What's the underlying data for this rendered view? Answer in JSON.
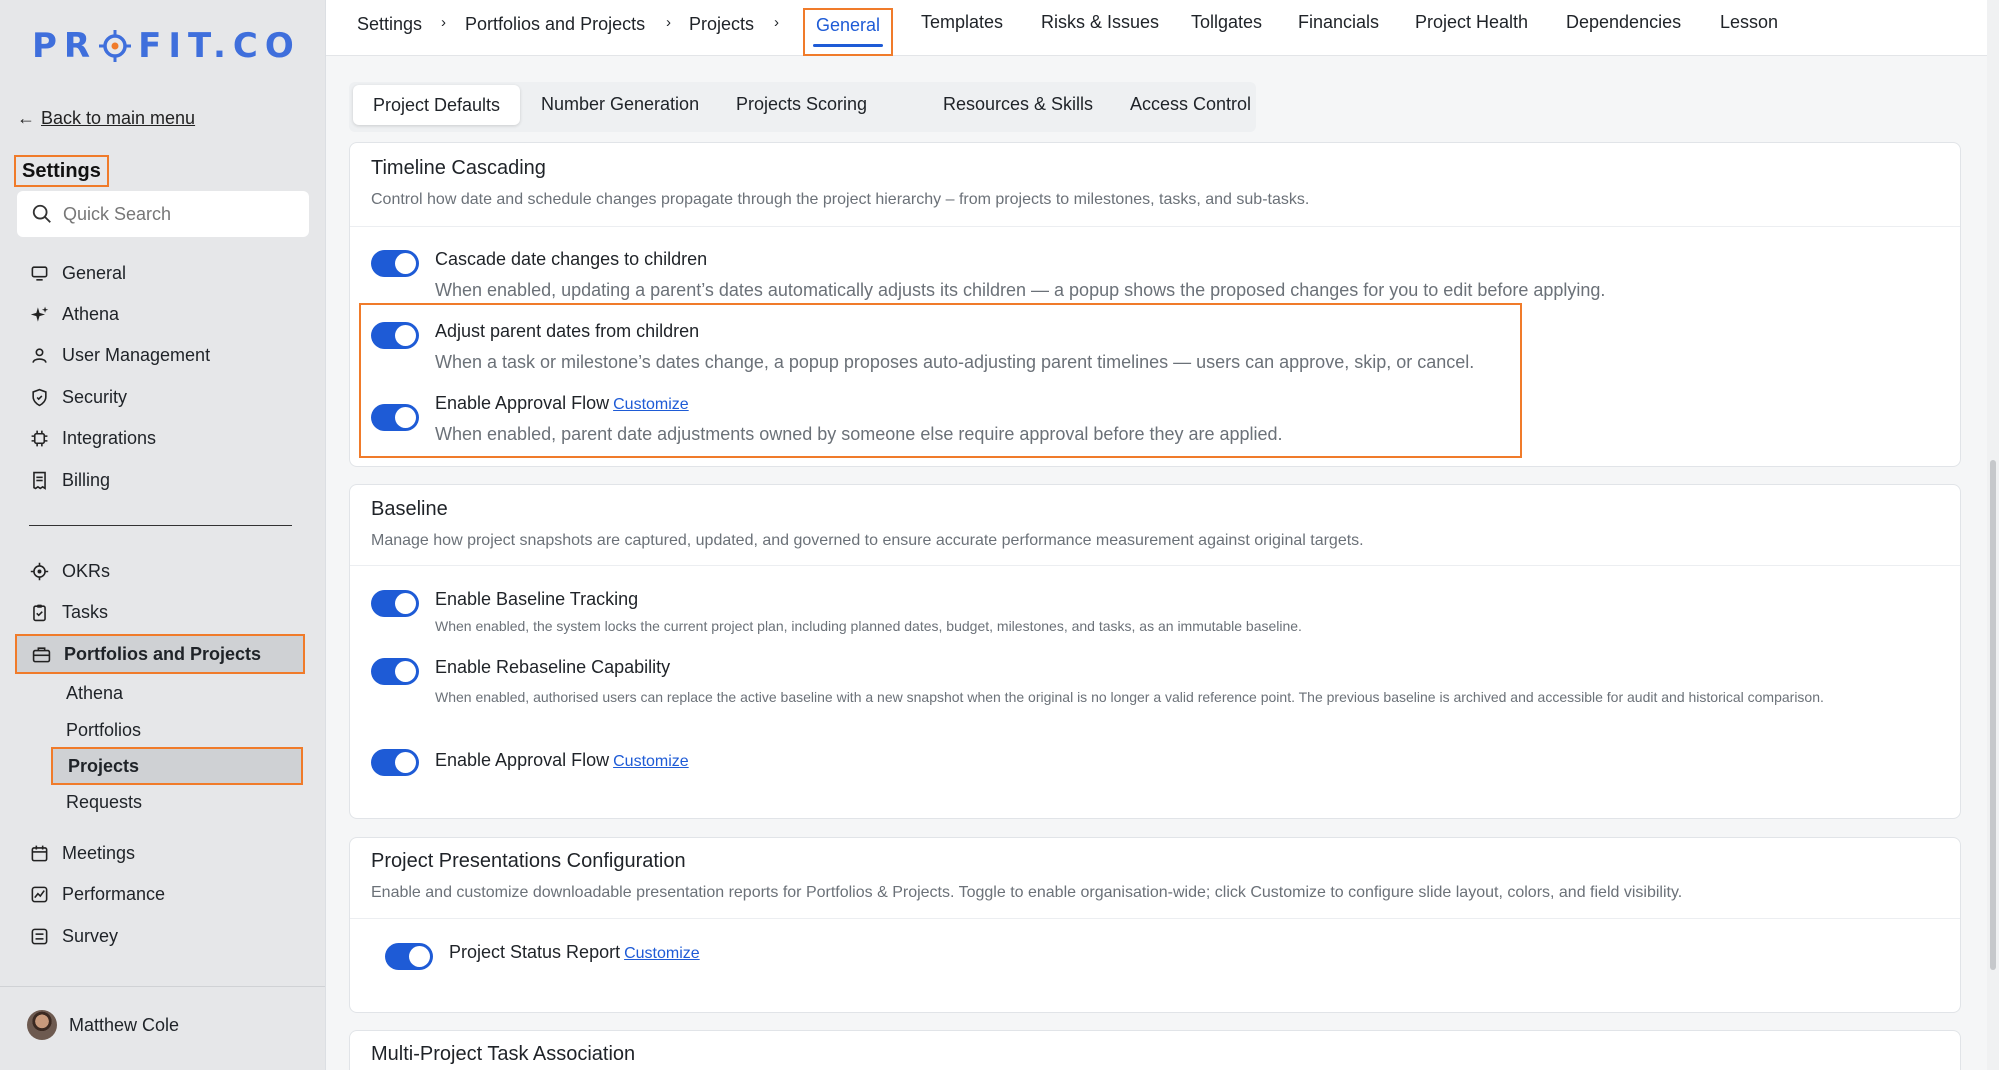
{
  "app": {
    "logo_text_left": "PR",
    "logo_text_right": "FIT.CO"
  },
  "sidebar": {
    "back_label": "Back to main menu",
    "settings_title": "Settings",
    "search_placeholder": "Quick Search",
    "items": [
      {
        "label": "General",
        "icon": "monitor-icon"
      },
      {
        "label": "Athena",
        "icon": "sparkle-icon"
      },
      {
        "label": "User Management",
        "icon": "user-icon"
      },
      {
        "label": "Security",
        "icon": "shield-icon"
      },
      {
        "label": "Integrations",
        "icon": "chip-icon"
      },
      {
        "label": "Billing",
        "icon": "receipt-icon"
      }
    ],
    "items2": [
      {
        "label": "OKRs",
        "icon": "target-icon"
      },
      {
        "label": "Tasks",
        "icon": "clipboard-check-icon"
      },
      {
        "label": "Portfolios and Projects",
        "icon": "briefcase-icon"
      }
    ],
    "sub_items": [
      "Athena",
      "Portfolios",
      "Projects",
      "Requests"
    ],
    "items3": [
      {
        "label": "Meetings",
        "icon": "calendar-icon"
      },
      {
        "label": "Performance",
        "icon": "chart-icon"
      },
      {
        "label": "Survey",
        "icon": "survey-icon"
      }
    ],
    "user_name": "Matthew Cole"
  },
  "breadcrumb": [
    "Settings",
    "Portfolios and Projects",
    "Projects"
  ],
  "tabs": [
    "General",
    "Templates",
    "Risks & Issues",
    "Tollgates",
    "Financials",
    "Project Health",
    "Dependencies",
    "Lesson"
  ],
  "subtabs": [
    "Project Defaults",
    "Number Generation",
    "Projects Scoring",
    "Resources & Skills",
    "Access Control"
  ],
  "timeline": {
    "title": "Timeline Cascading",
    "desc": "Control how date and schedule changes propagate through the project hierarchy – from projects to milestones, tasks, and sub-tasks.",
    "options": [
      {
        "label": "Cascade date changes to children",
        "desc": "When enabled, updating a parent’s dates automatically adjusts its children — a popup shows the proposed changes for you to edit before applying."
      },
      {
        "label": "Adjust parent dates from children",
        "desc": "When a task or milestone’s dates change, a popup proposes auto-adjusting parent timelines — users can approve, skip, or cancel."
      },
      {
        "label": "Enable Approval Flow",
        "link": "Customize",
        "desc": "When enabled, parent date adjustments owned by someone else require approval before they are applied."
      }
    ]
  },
  "baseline": {
    "title": "Baseline",
    "desc": "Manage how project snapshots are captured, updated, and governed to ensure accurate performance measurement against original targets.",
    "options": [
      {
        "label": "Enable Baseline Tracking",
        "desc": "When enabled, the system locks the current project plan, including planned dates, budget, milestones, and tasks, as an immutable baseline."
      },
      {
        "label": "Enable Rebaseline Capability",
        "desc": "When enabled, authorised users can replace the active baseline with a new snapshot when the original is no longer a valid reference point. The previous baseline is archived and accessible for audit and historical comparison."
      },
      {
        "label": "Enable Approval Flow",
        "link": "Customize"
      }
    ]
  },
  "presentations": {
    "title": "Project Presentations Configuration",
    "desc": "Enable and customize downloadable presentation reports for Portfolios & Projects. Toggle to enable organisation-wide; click Customize to configure slide layout, colors, and field visibility.",
    "options": [
      {
        "label": "Project Status Report",
        "link": "Customize"
      }
    ]
  },
  "multi": {
    "title": "Multi-Project Task Association"
  },
  "colors": {
    "accent": "#1e5bd6",
    "highlight": "#f07b2a"
  }
}
